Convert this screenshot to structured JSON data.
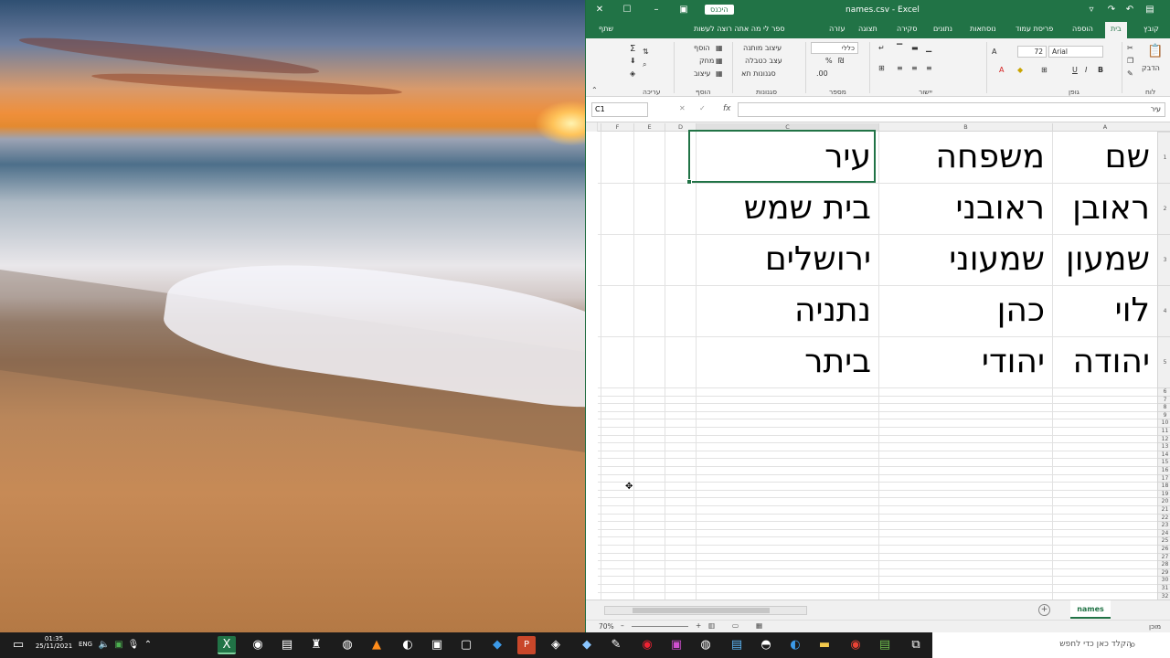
{
  "window": {
    "title": "names.csv - Excel",
    "signin": "היכנס",
    "share": "שתף",
    "tell_me": "ספר לי מה אתה רוצה לעשות"
  },
  "ribbon": {
    "tabs": [
      "קובץ",
      "בית",
      "הוספה",
      "פריסת עמוד",
      "נוסחאות",
      "נתונים",
      "סקירה",
      "תצוגה",
      "עזרה"
    ],
    "active_tab": "בית",
    "groups": [
      "לוח",
      "גופן",
      "יישור",
      "מספר",
      "סגנונות",
      "תאים",
      "עריכה"
    ],
    "font_name": "Arial",
    "font_size": "72",
    "number_format": "כללי",
    "paste": "הדבק",
    "styles": [
      "עיצוב מותנה",
      "עצב כטבלה",
      "סגנונות תא"
    ],
    "cells": [
      "הוסף",
      "מחק",
      "עיצוב"
    ]
  },
  "formula_bar": {
    "name_box": "C1",
    "fx": "fx",
    "content": "עיר"
  },
  "columns": [
    "A",
    "B",
    "C",
    "D",
    "E",
    "F"
  ],
  "rows": [
    "1",
    "2",
    "3",
    "4",
    "5",
    "6",
    "7",
    "8",
    "9",
    "10",
    "11",
    "12",
    "13",
    "14",
    "15",
    "16",
    "17",
    "18",
    "19",
    "20",
    "21",
    "22",
    "23",
    "24",
    "25",
    "26",
    "27",
    "28",
    "29",
    "30",
    "31",
    "32"
  ],
  "table": [
    [
      "שם",
      "משפחה",
      "עיר"
    ],
    [
      "ראובן",
      "ראובני",
      "בית שמש"
    ],
    [
      "שמעון",
      "שמעוני",
      "ירושלים"
    ],
    [
      "לוי",
      "כהן",
      "נתניה"
    ],
    [
      "יהודה",
      "יהודי",
      "ביתר"
    ]
  ],
  "sheet_tab": "names",
  "status": {
    "ready": "מוכן",
    "zoom": "70%"
  },
  "taskbar": {
    "search_placeholder": "הקלד כאן כדי לחפש",
    "time": "01:35",
    "date": "25/11/2021",
    "language": "ENG"
  }
}
